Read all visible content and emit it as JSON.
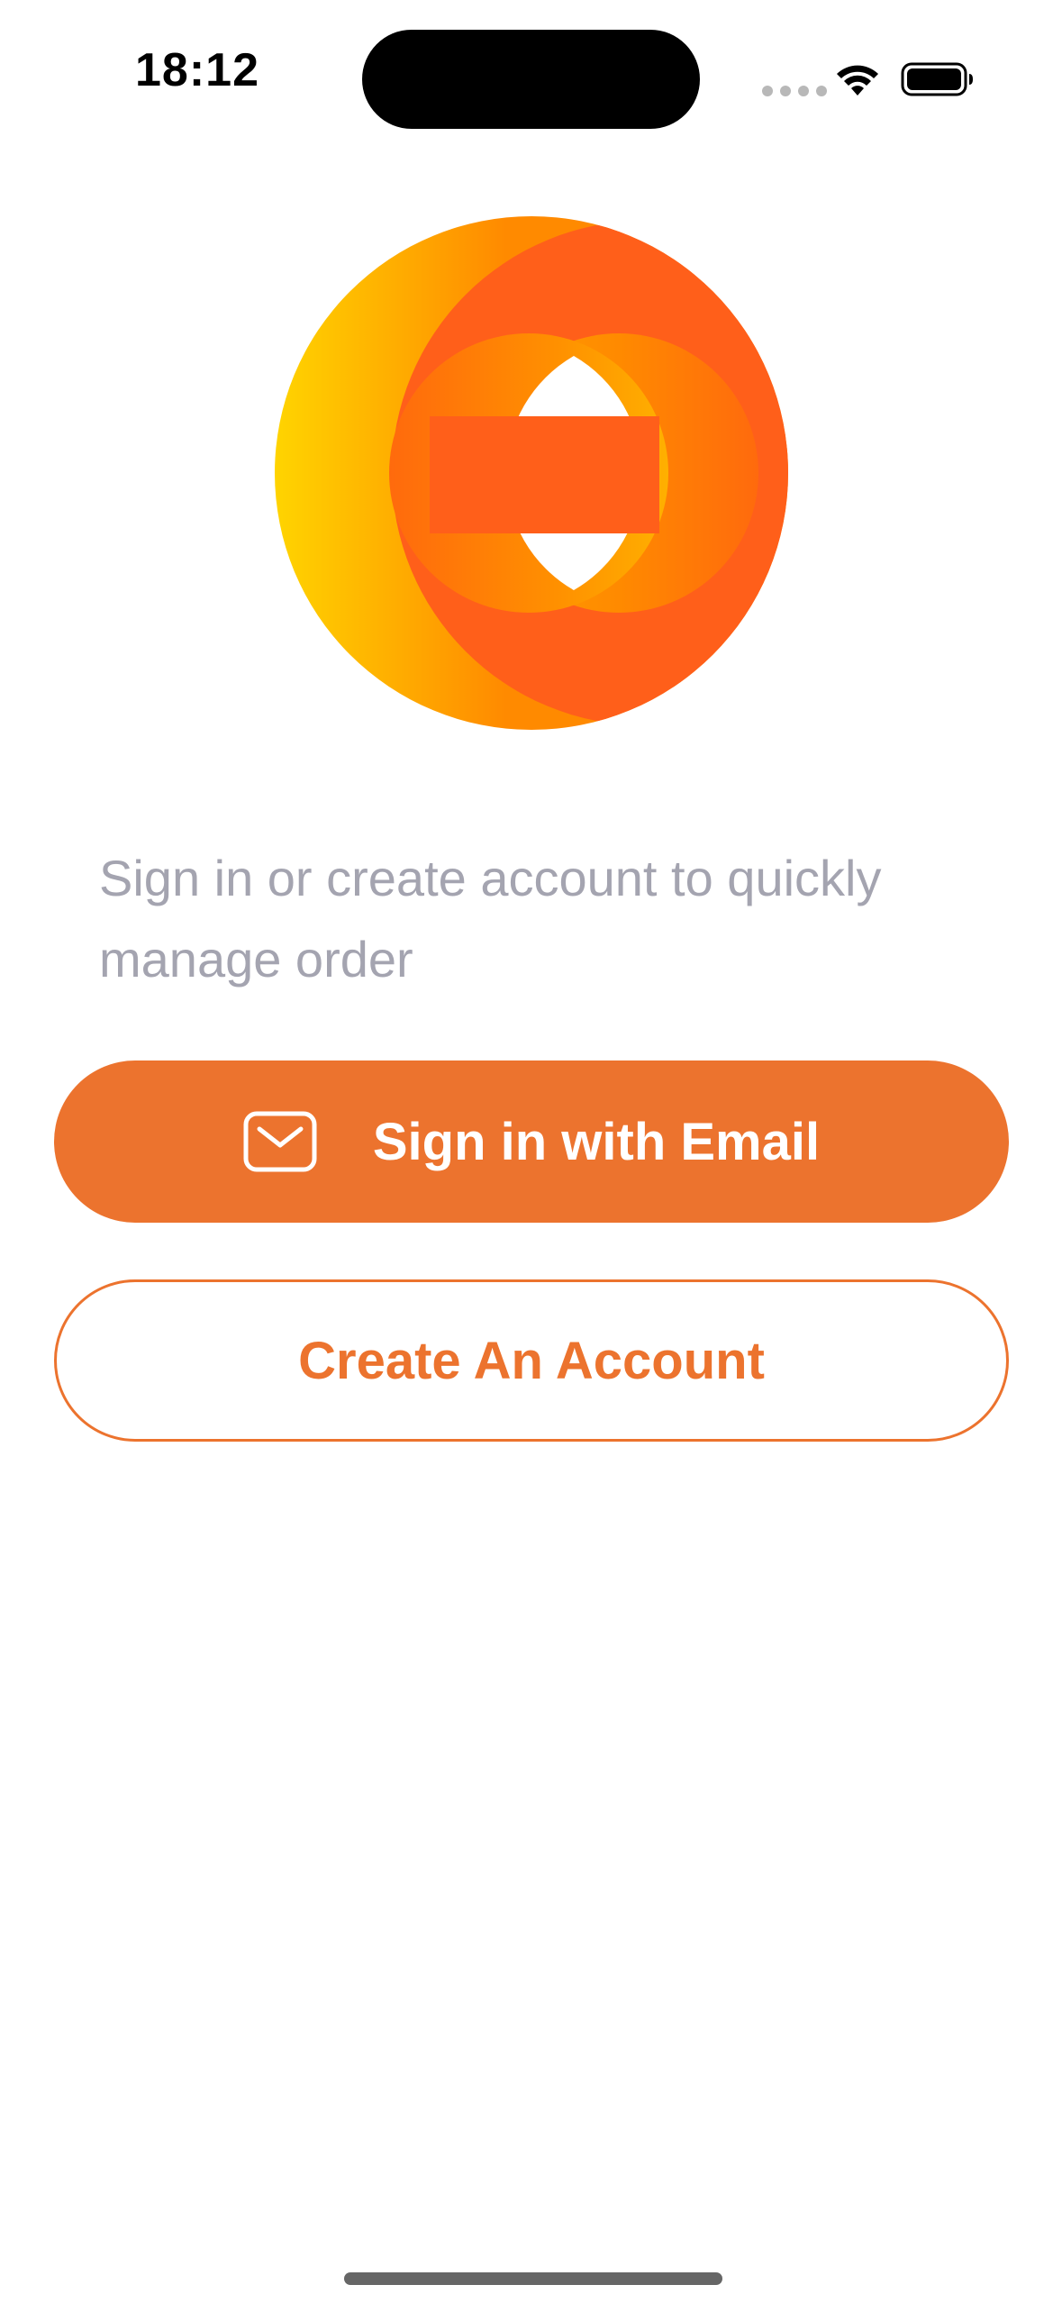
{
  "status_bar": {
    "time": "18:12",
    "icons": [
      "cellular-signal-icon",
      "wifi-icon",
      "battery-icon"
    ]
  },
  "logo": {
    "icon": "brand-logo-icon",
    "colors": [
      "#ffd400",
      "#ff8a00",
      "#ff5f1a"
    ]
  },
  "subtitle": "Sign in or create account to quickly manage order",
  "buttons": {
    "email_label": "Sign in with Email",
    "email_icon": "mail-icon",
    "create_label": "Create An Account"
  },
  "colors": {
    "accent": "#ec732e",
    "subtitle_text": "#a4a4b0",
    "background": "#ffffff"
  }
}
